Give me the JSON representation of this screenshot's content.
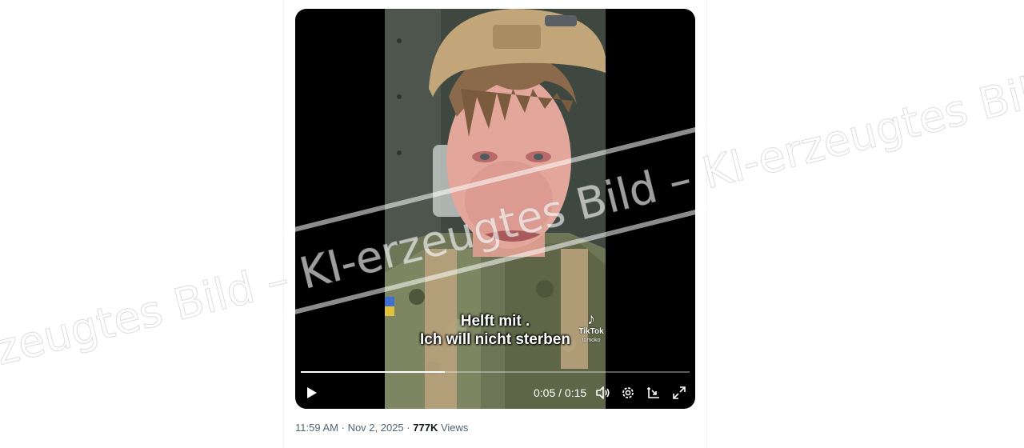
{
  "video": {
    "subtitle_line1": "Helft mit .",
    "subtitle_line2": "Ich will nicht sterben",
    "tiktok_label": "TikTok",
    "tiktok_handle": "tomoko",
    "progress_fraction": 0.37,
    "current_time": "0:05",
    "time_separator": "/",
    "duration": "0:15"
  },
  "tweet": {
    "time": "11:59 AM",
    "separator": "·",
    "date": "Nov 2, 2025",
    "views_count": "777K",
    "views_label": "Views"
  },
  "watermark": {
    "text": "KI-erzeugtes Bild – KI-erzeugtes Bild – KI-erzeugtes Bild – KI-erzeugtes Bild"
  },
  "icons": [
    "play-icon",
    "volume-icon",
    "gear-icon",
    "picture-in-picture-icon",
    "fullscreen-icon",
    "tiktok-icon"
  ]
}
